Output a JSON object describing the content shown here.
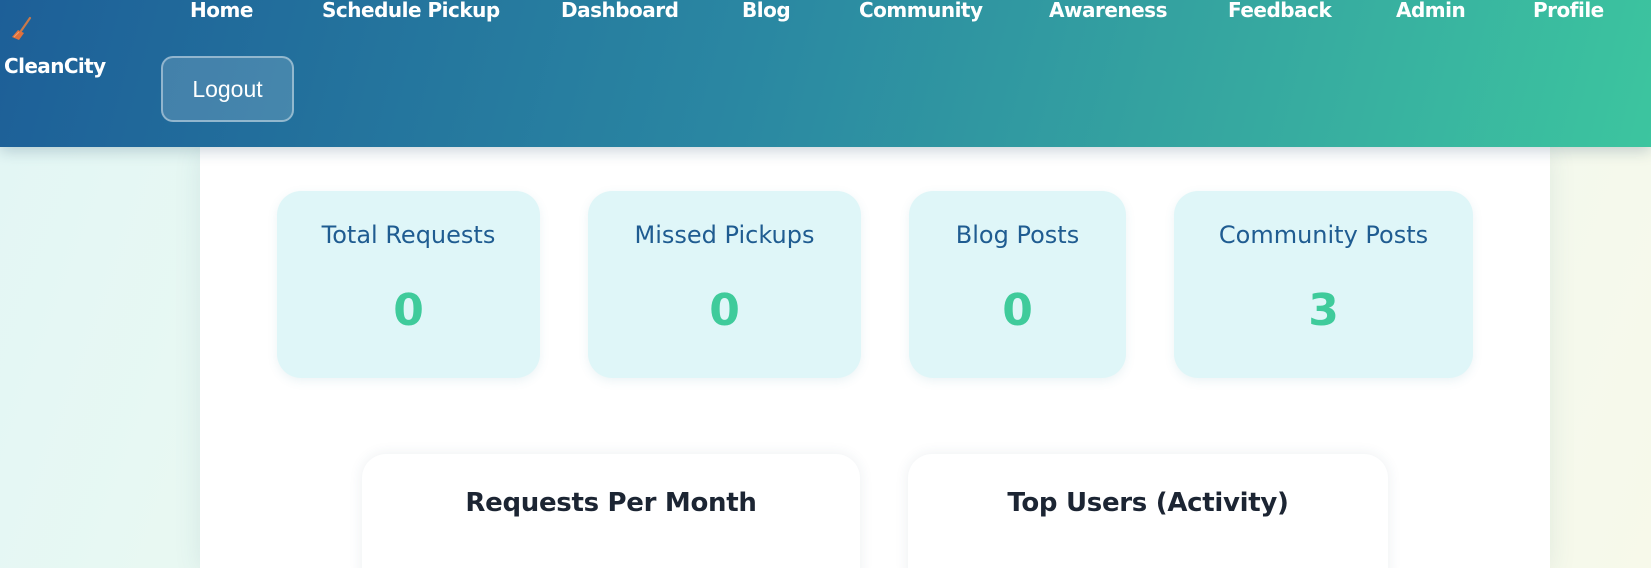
{
  "brand": {
    "name": "CleanCity",
    "icon": "broom-icon"
  },
  "nav": {
    "items": [
      "Home",
      "Schedule Pickup",
      "Dashboard",
      "Blog",
      "Community",
      "Awareness",
      "Feedback",
      "Admin",
      "Profile"
    ],
    "logout_label": "Logout"
  },
  "stats": [
    {
      "label": "Total Requests",
      "value": "0"
    },
    {
      "label": "Missed Pickups",
      "value": "0"
    },
    {
      "label": "Blog Posts",
      "value": "0"
    },
    {
      "label": "Community Posts",
      "value": "3"
    }
  ],
  "charts": [
    {
      "title": "Requests Per Month"
    },
    {
      "title": "Top Users (Activity)"
    }
  ],
  "colors": {
    "header_start": "#1d5f98",
    "header_end": "#3cc59f",
    "stat_bg": "#dff6f8",
    "stat_label": "#1f5c91",
    "stat_value": "#3fcb9b"
  }
}
